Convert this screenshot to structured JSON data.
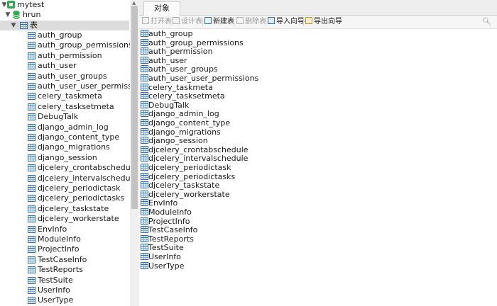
{
  "tree": {
    "connection": "mytest",
    "database": "hrun",
    "tables_node": "表",
    "tables": [
      "auth_group",
      "auth_group_permissions",
      "auth_permission",
      "auth_user",
      "auth_user_groups",
      "auth_user_user_permissions",
      "celery_taskmeta",
      "celery_tasksetmeta",
      "DebugTalk",
      "django_admin_log",
      "django_content_type",
      "django_migrations",
      "django_session",
      "djcelery_crontabschedule",
      "djcelery_intervalschedule",
      "djcelery_periodictask",
      "djcelery_periodictasks",
      "djcelery_taskstate",
      "djcelery_workerstate",
      "EnvInfo",
      "ModuleInfo",
      "ProjectInfo",
      "TestCaseInfo",
      "TestReports",
      "TestSuite",
      "UserInfo",
      "UserType"
    ]
  },
  "tab": {
    "label": "对象"
  },
  "toolbar": {
    "open": "打开表",
    "design": "设计表",
    "new": "新建表",
    "delete": "删除表",
    "import": "导入向导",
    "export": "导出向导"
  },
  "objects": [
    "auth_group",
    "auth_group_permissions",
    "auth_permission",
    "auth_user",
    "auth_user_groups",
    "auth_user_user_permissions",
    "celery_taskmeta",
    "celery_tasksetmeta",
    "DebugTalk",
    "django_admin_log",
    "django_content_type",
    "django_migrations",
    "django_session",
    "djcelery_crontabschedule",
    "djcelery_intervalschedule",
    "djcelery_periodictask",
    "djcelery_periodictasks",
    "djcelery_taskstate",
    "djcelery_workerstate",
    "EnvInfo",
    "ModuleInfo",
    "ProjectInfo",
    "TestCaseInfo",
    "TestReports",
    "TestSuite",
    "UserInfo",
    "UserType"
  ],
  "icons": {
    "connection": "connection-icon",
    "database": "database-icon",
    "table": "table-icon",
    "search": "search-icon"
  },
  "colors": {
    "connection": "#2fa84f",
    "table": "#2f6fb6",
    "selected_row": "#dcdcdc"
  }
}
